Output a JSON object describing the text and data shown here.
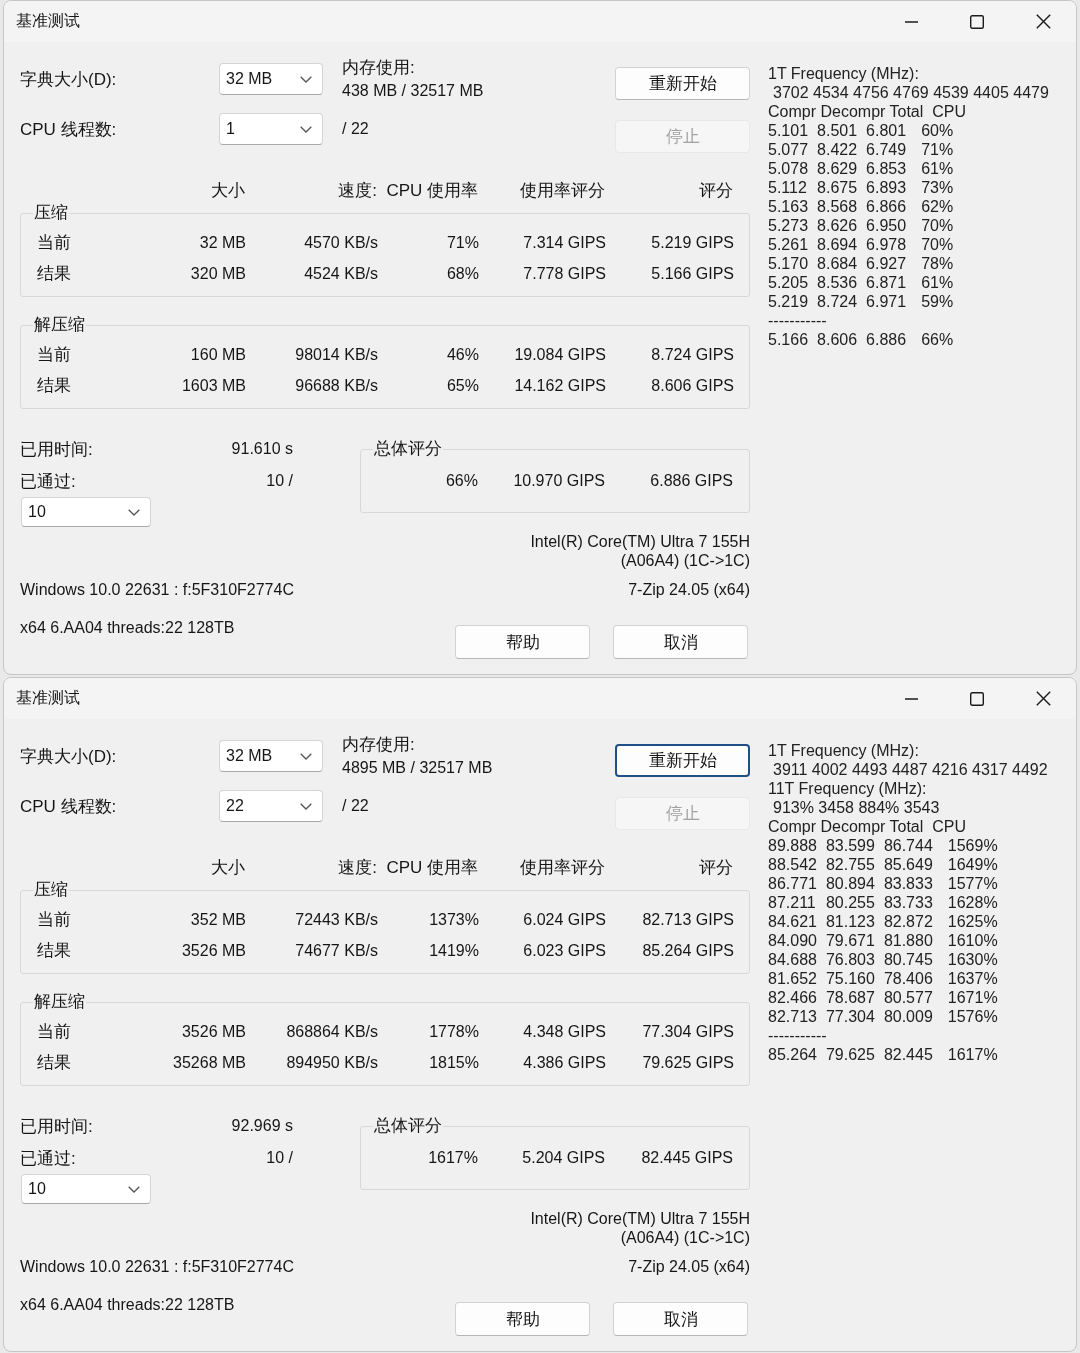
{
  "windows": [
    {
      "title": "基准测试",
      "dictionary": {
        "label": "字典大小(D):",
        "value": "32 MB"
      },
      "threads": {
        "label": "CPU 线程数:",
        "value": "1",
        "max": "/ 22"
      },
      "memory": {
        "label": "内存使用:",
        "value": "438 MB / 32517 MB"
      },
      "buttons": [
        {
          "label": "重新开始",
          "disabled": false,
          "focused": false
        },
        {
          "label": "停止",
          "disabled": true,
          "focused": false
        }
      ],
      "columns": [
        "大小",
        "速度:",
        "CPU 使用率",
        "使用率评分",
        "评分"
      ],
      "groups": [
        {
          "title": "压缩",
          "rows": [
            {
              "label": "当前",
              "cells": [
                "32 MB",
                "4570 KB/s",
                "71%",
                "7.314 GIPS",
                "5.219 GIPS"
              ]
            },
            {
              "label": "结果",
              "cells": [
                "320 MB",
                "4524 KB/s",
                "68%",
                "7.778 GIPS",
                "5.166 GIPS"
              ]
            }
          ]
        },
        {
          "title": "解压缩",
          "rows": [
            {
              "label": "当前",
              "cells": [
                "160 MB",
                "98014 KB/s",
                "46%",
                "19.084 GIPS",
                "8.724 GIPS"
              ]
            },
            {
              "label": "结果",
              "cells": [
                "1603 MB",
                "96688 KB/s",
                "65%",
                "14.162 GIPS",
                "8.606 GIPS"
              ]
            }
          ]
        }
      ],
      "elapsed": {
        "label": "已用时间:",
        "value": "91.610 s"
      },
      "passed": {
        "label": "已通过:",
        "value": "10 /"
      },
      "passes_value": "10",
      "overall": {
        "title": "总体评分",
        "cells": [
          "66%",
          "10.970 GIPS",
          "6.886 GIPS"
        ]
      },
      "cpu_info": [
        "Intel(R) Core(TM) Ultra 7 155H",
        "(A06A4) (1C->1C)"
      ],
      "os_info": "Windows 10.0 22631 : f:5F310F2774C",
      "version": "7-Zip 24.05 (x64)",
      "build_info": "x64 6.AA04 threads:22 128TB",
      "dialog_buttons": [
        {
          "label": "帮助",
          "disabled": false,
          "focused": false
        },
        {
          "label": "取消",
          "disabled": false,
          "focused": false
        }
      ],
      "log": [
        {
          "kind": "heading",
          "text": "1T Frequency (MHz):"
        },
        {
          "kind": "values",
          "text": "3702 4534 4756 4769 4539 4405 4479"
        },
        {
          "kind": "columns",
          "text": "Compr Decompr Total  CPU"
        },
        {
          "kind": "row",
          "cells": [
            "5.101",
            "8.501",
            "6.801",
            "60%"
          ]
        },
        {
          "kind": "row",
          "cells": [
            "5.077",
            "8.422",
            "6.749",
            "71%"
          ]
        },
        {
          "kind": "row",
          "cells": [
            "5.078",
            "8.629",
            "6.853",
            "61%"
          ]
        },
        {
          "kind": "row",
          "cells": [
            "5.112",
            "8.675",
            "6.893",
            "73%"
          ]
        },
        {
          "kind": "row",
          "cells": [
            "5.163",
            "8.568",
            "6.866",
            "62%"
          ]
        },
        {
          "kind": "row",
          "cells": [
            "5.273",
            "8.626",
            "6.950",
            "70%"
          ]
        },
        {
          "kind": "row",
          "cells": [
            "5.261",
            "8.694",
            "6.978",
            "70%"
          ]
        },
        {
          "kind": "row",
          "cells": [
            "5.170",
            "8.684",
            "6.927",
            "78%"
          ]
        },
        {
          "kind": "row",
          "cells": [
            "5.205",
            "8.536",
            "6.871",
            "61%"
          ]
        },
        {
          "kind": "row",
          "cells": [
            "5.219",
            "8.724",
            "6.971",
            "59%"
          ]
        },
        {
          "kind": "separator",
          "text": "-----------"
        },
        {
          "kind": "row",
          "cells": [
            "5.166",
            "8.606",
            "6.886",
            "66%"
          ]
        }
      ]
    },
    {
      "title": "基准测试",
      "dictionary": {
        "label": "字典大小(D):",
        "value": "32 MB"
      },
      "threads": {
        "label": "CPU 线程数:",
        "value": "22",
        "max": "/ 22"
      },
      "memory": {
        "label": "内存使用:",
        "value": "4895 MB / 32517 MB"
      },
      "buttons": [
        {
          "label": "重新开始",
          "disabled": false,
          "focused": true
        },
        {
          "label": "停止",
          "disabled": true,
          "focused": false
        }
      ],
      "columns": [
        "大小",
        "速度:",
        "CPU 使用率",
        "使用率评分",
        "评分"
      ],
      "groups": [
        {
          "title": "压缩",
          "rows": [
            {
              "label": "当前",
              "cells": [
                "352 MB",
                "72443 KB/s",
                "1373%",
                "6.024 GIPS",
                "82.713 GIPS"
              ]
            },
            {
              "label": "结果",
              "cells": [
                "3526 MB",
                "74677 KB/s",
                "1419%",
                "6.023 GIPS",
                "85.264 GIPS"
              ]
            }
          ]
        },
        {
          "title": "解压缩",
          "rows": [
            {
              "label": "当前",
              "cells": [
                "3526 MB",
                "868864 KB/s",
                "1778%",
                "4.348 GIPS",
                "77.304 GIPS"
              ]
            },
            {
              "label": "结果",
              "cells": [
                "35268 MB",
                "894950 KB/s",
                "1815%",
                "4.386 GIPS",
                "79.625 GIPS"
              ]
            }
          ]
        }
      ],
      "elapsed": {
        "label": "已用时间:",
        "value": "92.969 s"
      },
      "passed": {
        "label": "已通过:",
        "value": "10 /"
      },
      "passes_value": "10",
      "overall": {
        "title": "总体评分",
        "cells": [
          "1617%",
          "5.204 GIPS",
          "82.445 GIPS"
        ]
      },
      "cpu_info": [
        "Intel(R) Core(TM) Ultra 7 155H",
        "(A06A4) (1C->1C)"
      ],
      "os_info": "Windows 10.0 22631 : f:5F310F2774C",
      "version": "7-Zip 24.05 (x64)",
      "build_info": "x64 6.AA04 threads:22 128TB",
      "dialog_buttons": [
        {
          "label": "帮助",
          "disabled": false,
          "focused": false
        },
        {
          "label": "取消",
          "disabled": false,
          "focused": false
        }
      ],
      "log": [
        {
          "kind": "heading",
          "text": "1T Frequency (MHz):"
        },
        {
          "kind": "values",
          "text": "3911 4002 4493 4487 4216 4317 4492"
        },
        {
          "kind": "heading",
          "text": "11T Frequency (MHz):"
        },
        {
          "kind": "values",
          "text": "913% 3458 884% 3543"
        },
        {
          "kind": "columns",
          "text": "Compr Decompr Total  CPU"
        },
        {
          "kind": "row",
          "cells": [
            "89.888",
            "83.599",
            "86.744",
            "1569%"
          ]
        },
        {
          "kind": "row",
          "cells": [
            "88.542",
            "82.755",
            "85.649",
            "1649%"
          ]
        },
        {
          "kind": "row",
          "cells": [
            "86.771",
            "80.894",
            "83.833",
            "1577%"
          ]
        },
        {
          "kind": "row",
          "cells": [
            "87.211",
            "80.255",
            "83.733",
            "1628%"
          ]
        },
        {
          "kind": "row",
          "cells": [
            "84.621",
            "81.123",
            "82.872",
            "1625%"
          ]
        },
        {
          "kind": "row",
          "cells": [
            "84.090",
            "79.671",
            "81.880",
            "1610%"
          ]
        },
        {
          "kind": "row",
          "cells": [
            "84.688",
            "76.803",
            "80.745",
            "1630%"
          ]
        },
        {
          "kind": "row",
          "cells": [
            "81.652",
            "75.160",
            "78.406",
            "1637%"
          ]
        },
        {
          "kind": "row",
          "cells": [
            "82.466",
            "78.687",
            "80.577",
            "1671%"
          ]
        },
        {
          "kind": "row",
          "cells": [
            "82.713",
            "77.304",
            "80.009",
            "1576%"
          ]
        },
        {
          "kind": "separator",
          "text": "-----------"
        },
        {
          "kind": "row",
          "cells": [
            "85.264",
            "79.625",
            "82.445",
            "1617%"
          ]
        }
      ]
    }
  ]
}
